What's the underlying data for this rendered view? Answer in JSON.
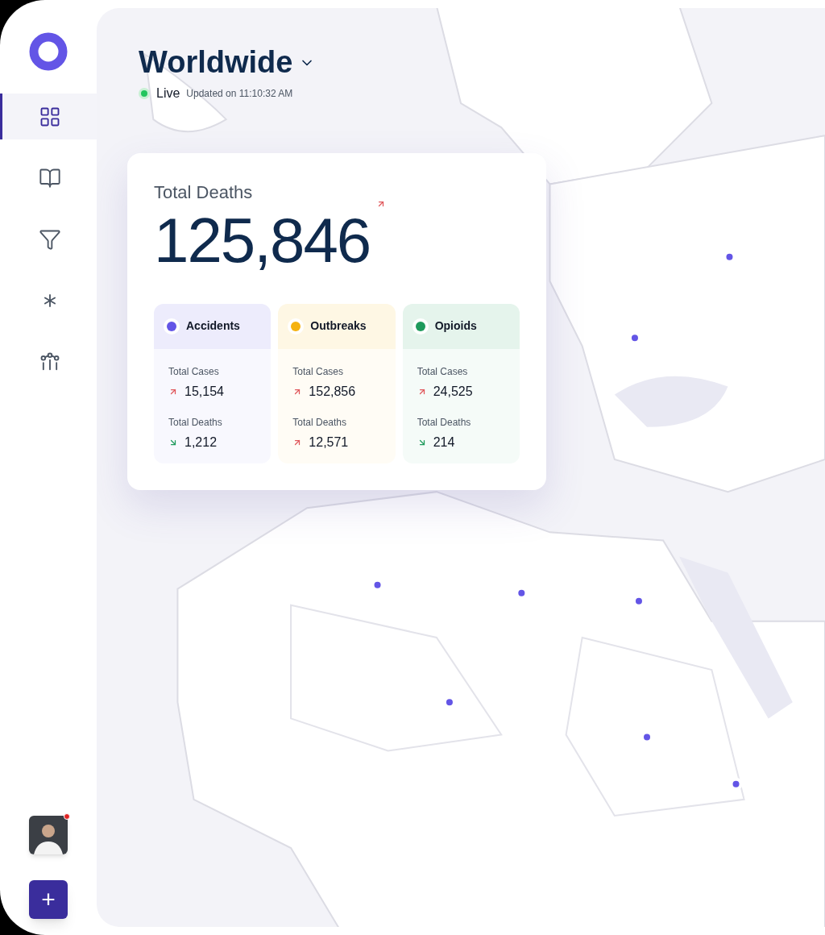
{
  "sidebar": {
    "items": [
      {
        "kind": "grid",
        "selected": true
      },
      {
        "kind": "book",
        "selected": false
      },
      {
        "kind": "filter",
        "selected": false
      },
      {
        "kind": "asterisk",
        "selected": false
      },
      {
        "kind": "nodes",
        "selected": false
      }
    ],
    "avatar": {
      "has_notification": true
    },
    "add_button": {
      "label": "+"
    }
  },
  "header": {
    "title": "Worldwide",
    "status": "Live",
    "live": true,
    "updated": "Updated on 11:10:32 AM"
  },
  "summary": {
    "title": "Total Deaths",
    "value": "125,846",
    "kind": "up",
    "categories": [
      {
        "name": "Accidents",
        "color": "#6355e6",
        "stats": [
          {
            "label": "Total Cases",
            "value": "15,154",
            "kind": "up"
          },
          {
            "label": "Total Deaths",
            "value": "1,212",
            "kind": "down"
          }
        ]
      },
      {
        "name": "Outbreaks",
        "color": "#f5b20f",
        "stats": [
          {
            "label": "Total Cases",
            "value": "152,856",
            "kind": "up"
          },
          {
            "label": "Total Deaths",
            "value": "12,571",
            "kind": "up"
          }
        ]
      },
      {
        "name": "Opioids",
        "color": "#1f9a5c",
        "stats": [
          {
            "label": "Total Cases",
            "value": "24,525",
            "kind": "up"
          },
          {
            "label": "Total Deaths",
            "value": "214",
            "kind": "down"
          }
        ]
      }
    ]
  }
}
